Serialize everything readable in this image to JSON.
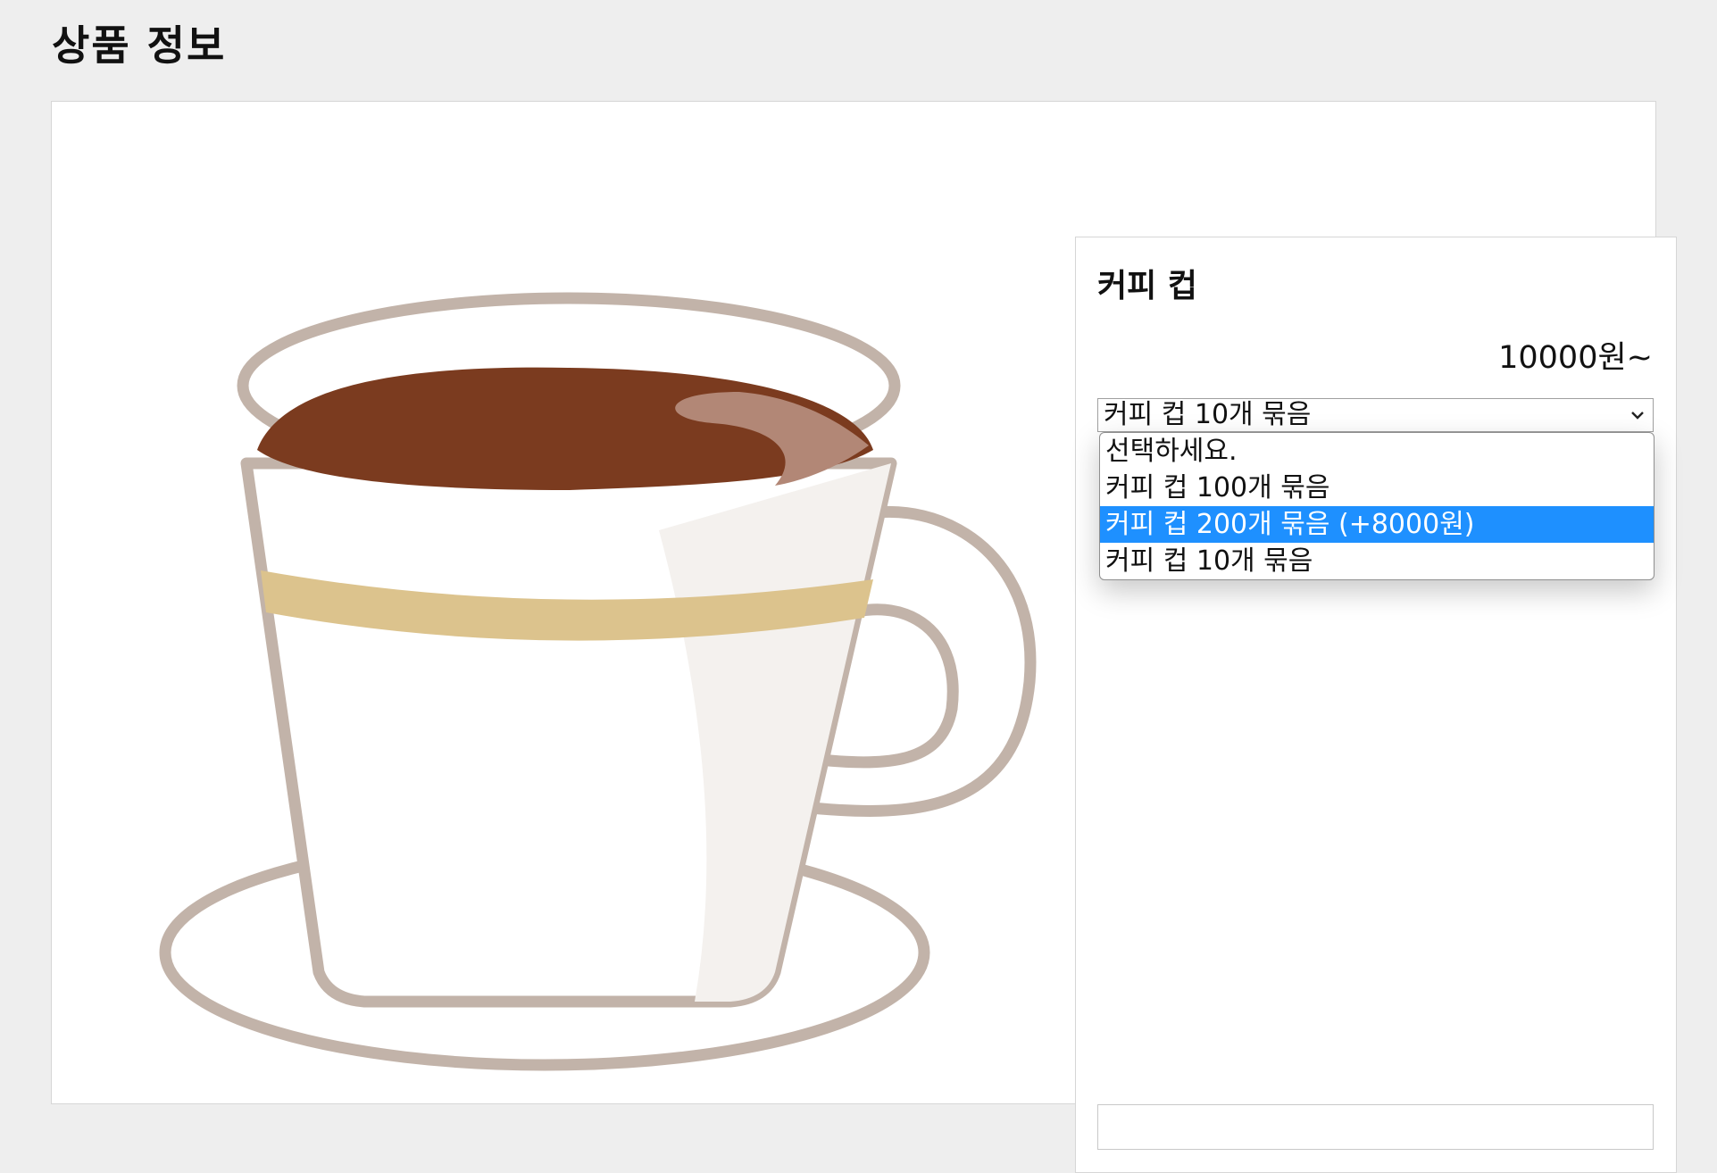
{
  "page": {
    "title": "상품 정보"
  },
  "product": {
    "image_icon": "coffee-cup-illustration",
    "name": "커피 컵",
    "price": "10000원~"
  },
  "option_select": {
    "selected": "커피 컵 10개 묶음",
    "chevron_icon": "chevron-down-icon",
    "options": [
      {
        "label": "선택하세요.",
        "highlighted": false
      },
      {
        "label": "커피 컵 100개 묶음",
        "highlighted": false
      },
      {
        "label": "커피 컵 200개 묶음 (+8000원)",
        "highlighted": true
      },
      {
        "label": "커피 컵 10개 묶음",
        "highlighted": false
      }
    ]
  },
  "colors": {
    "background": "#eeeeee",
    "highlight": "#1e90ff",
    "coffee": "#7b3b1f",
    "cup_outline": "#c2b3a9",
    "cup_band": "#dcc38d"
  }
}
